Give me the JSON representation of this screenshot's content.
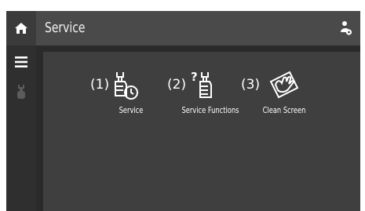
{
  "header": {
    "title": "Service",
    "home_icon": "home-icon",
    "user_icon": "user-settings-icon"
  },
  "sidebar": {
    "menu_icon": "hamburger-menu-icon",
    "item_icon": "service-wrench-icon"
  },
  "tiles": [
    {
      "number": "(1)",
      "label": "Service",
      "icon": "wrench-clock-icon"
    },
    {
      "number": "(2)",
      "label": "Service Functions",
      "icon": "wrench-question-icon"
    },
    {
      "number": "(3)",
      "label": "Clean Screen",
      "icon": "hand-wipe-icon"
    }
  ],
  "colors": {
    "topbar": "#4a4a4a",
    "background": "#2a2a2a",
    "content_panel": "#3f3f3f",
    "text": "#ffffff"
  }
}
